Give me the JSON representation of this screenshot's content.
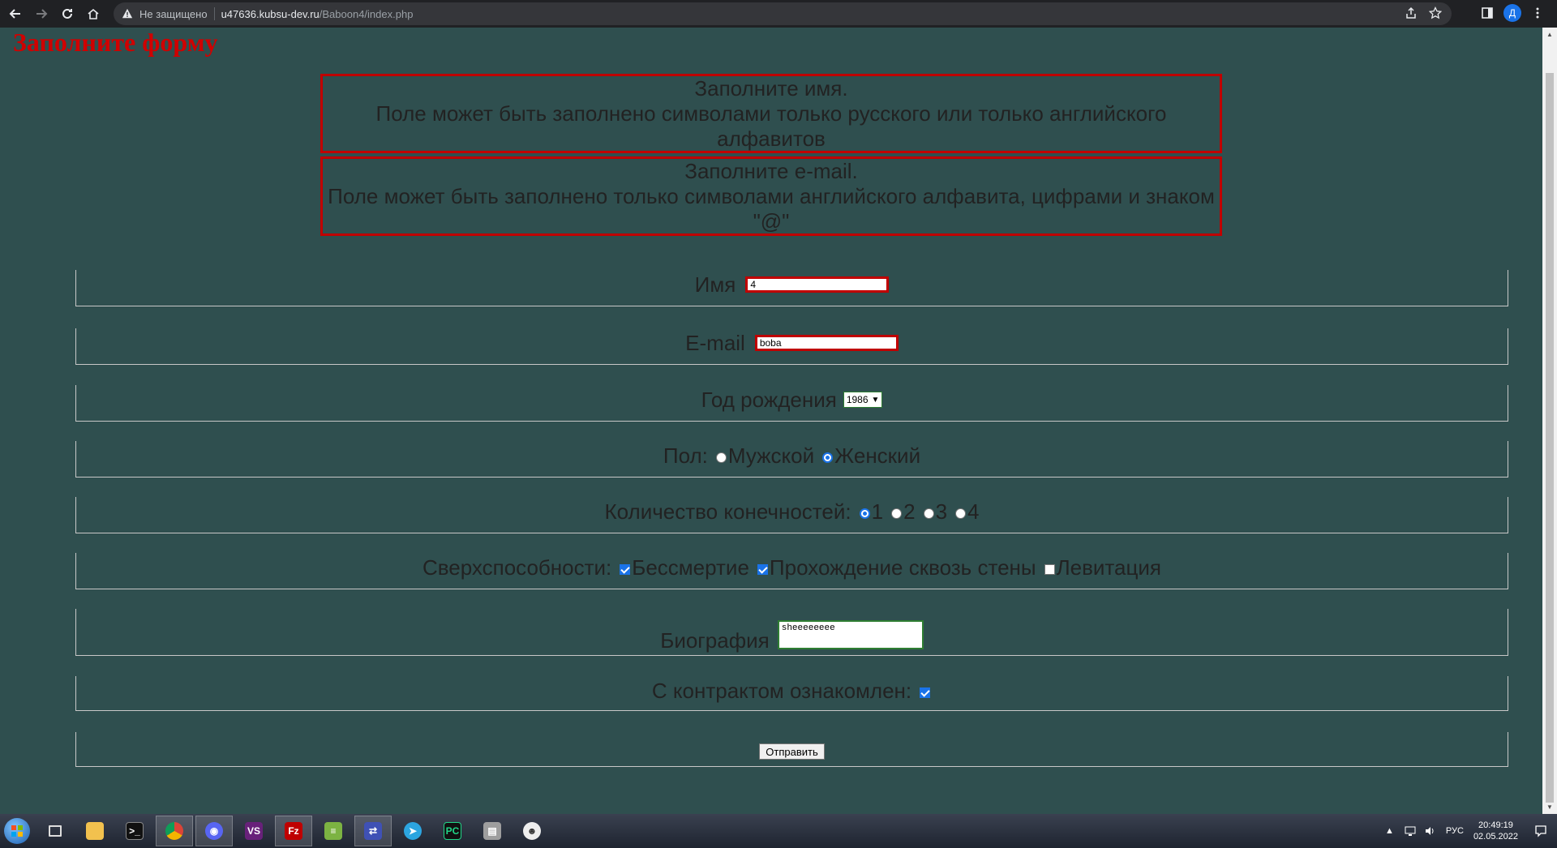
{
  "browser": {
    "insecure_label": "Не защищено",
    "url_host": "u47636.kubsu-dev.ru",
    "url_path": "/Baboon4/index.php",
    "profile_initial": "Д"
  },
  "page": {
    "title": "Заполните форму",
    "errors": {
      "name_line1": "Заполните имя.",
      "name_line2": "Поле может быть заполнено символами только русского или только английского алфавитов",
      "email_line1": "Заполните e-mail.",
      "email_line2": "Поле может быть заполнено только символами английского алфавита, цифрами и знаком \"@\""
    },
    "form": {
      "name_label": "Имя",
      "name_value": "4",
      "email_label": "E-mail",
      "email_value": "boba",
      "year_label": "Год рождения",
      "year_value": "1986",
      "gender_label": "Пол:",
      "gender_male": "Мужской",
      "gender_female": "Женский",
      "limbs_label": "Количество конечностей:",
      "limbs_1": "1",
      "limbs_2": "2",
      "limbs_3": "3",
      "limbs_4": "4",
      "powers_label": "Сверхспособности:",
      "power_immortality": "Бессмертие",
      "power_walls": "Прохождение сквозь стены",
      "power_levitation": "Левитация",
      "bio_label": "Биография",
      "bio_value": "sheeeeeeee",
      "contract_label": "С контрактом ознакомлен:",
      "submit_label": "Отправить"
    }
  },
  "taskbar": {
    "language": "РУС",
    "time": "20:49:19",
    "date": "02.05.2022"
  },
  "colors": {
    "page_bg": "#2f4f4f",
    "title_red": "#d00000",
    "error_border": "#c00000",
    "accent_blue": "#1a73e8"
  }
}
